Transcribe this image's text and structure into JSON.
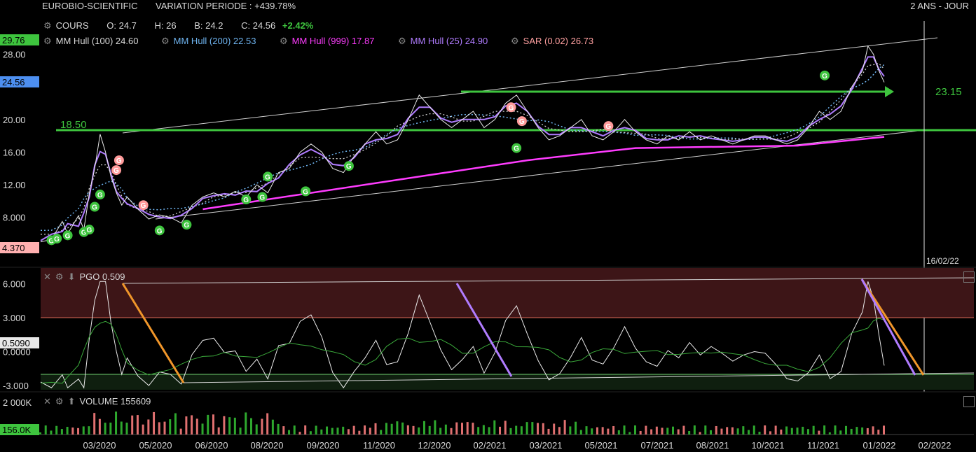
{
  "header": {
    "symbol": "EUROBIO-SCIENTIFIC",
    "variation": "VARIATION PERIODE : +439.78%",
    "period": "2 ANS - JOUR"
  },
  "ohlc": {
    "label": "COURS",
    "o_label": "O:",
    "o": "24.7",
    "h_label": "H:",
    "h": "26",
    "b_label": "B:",
    "b": "24.2",
    "c_label": "C:",
    "c": "24.56",
    "change": "+2.42%"
  },
  "legend": [
    {
      "name": "MM Hull (100)",
      "value": "24.60",
      "color": "#d0d0d0"
    },
    {
      "name": "MM Hull (200)",
      "value": "22.53",
      "color": "#6fb4f0"
    },
    {
      "name": "MM Hull (999)",
      "value": "17.87",
      "color": "#ff3cff"
    },
    {
      "name": "MM Hull (25)",
      "value": "24.90",
      "color": "#b07cff"
    },
    {
      "name": "SAR (0.02)",
      "value": "26.73",
      "color": "#ffa0a0"
    }
  ],
  "price_axis": {
    "ticks": [
      "28.00",
      "20.00",
      "16.00",
      "12.00",
      "8.000"
    ],
    "badge_high": "29.76",
    "badge_last": "24.56",
    "badge_low": "4.370",
    "level_1": "18.50",
    "level_2": "23.15"
  },
  "cursor_date": "16/02/22",
  "pgo": {
    "label": "PGO",
    "value": "0.509",
    "ticks": [
      "6.000",
      "3.000",
      "0.0000",
      "-3.000"
    ],
    "badge": "0.5090"
  },
  "volume": {
    "label": "VOLUME",
    "value": "155609",
    "top_tick": "2 000K",
    "badge": "156.0K"
  },
  "x_axis": [
    "03/2020",
    "05/2020",
    "06/2020",
    "08/2020",
    "09/2020",
    "11/2020",
    "12/2020",
    "02/2021",
    "03/2021",
    "05/2021",
    "07/2021",
    "08/2021",
    "10/2021",
    "11/2021",
    "01/2022",
    "02/2022"
  ],
  "colors": {
    "green": "#3ec43e",
    "pink": "#ff9a9a",
    "purple": "#b07cff",
    "magenta": "#ff3cff",
    "blue": "#6fb4f0",
    "orange": "#f0962a",
    "overbought_zone": "#3d1517",
    "oversold_zone": "#0f1f0f"
  },
  "chart_data": {
    "type": "line",
    "title": "EUROBIO-SCIENTIFIC",
    "x_range": [
      "01/2020",
      "02/2022"
    ],
    "price_ylim": [
      4.37,
      29.76
    ],
    "series": [
      {
        "name": "COURS",
        "points": [
          [
            0,
            5.0
          ],
          [
            2,
            5.3
          ],
          [
            4,
            7.5
          ],
          [
            5,
            6.0
          ],
          [
            7,
            8.2
          ],
          [
            8,
            6.5
          ],
          [
            9,
            11
          ],
          [
            10,
            14
          ],
          [
            11,
            18.2
          ],
          [
            12,
            16
          ],
          [
            13,
            13
          ],
          [
            14,
            11
          ],
          [
            15,
            9.5
          ],
          [
            16,
            10.5
          ],
          [
            18,
            9
          ],
          [
            20,
            7.8
          ],
          [
            22,
            8.3
          ],
          [
            24,
            8
          ],
          [
            26,
            7.3
          ],
          [
            28,
            9.5
          ],
          [
            30,
            10.5
          ],
          [
            32,
            11
          ],
          [
            34,
            10.5
          ],
          [
            36,
            11.2
          ],
          [
            38,
            10.5
          ],
          [
            40,
            12
          ],
          [
            42,
            11
          ],
          [
            44,
            13.5
          ],
          [
            46,
            14
          ],
          [
            48,
            16
          ],
          [
            50,
            17
          ],
          [
            52,
            16
          ],
          [
            54,
            14
          ],
          [
            56,
            13.5
          ],
          [
            58,
            15.5
          ],
          [
            60,
            17
          ],
          [
            62,
            18.5
          ],
          [
            64,
            17
          ],
          [
            66,
            17.5
          ],
          [
            68,
            20
          ],
          [
            70,
            23
          ],
          [
            72,
            21.5
          ],
          [
            74,
            20
          ],
          [
            76,
            19
          ],
          [
            78,
            20
          ],
          [
            80,
            21
          ],
          [
            82,
            19
          ],
          [
            84,
            20
          ],
          [
            86,
            22
          ],
          [
            88,
            23
          ],
          [
            90,
            21
          ],
          [
            92,
            19
          ],
          [
            94,
            17.5
          ],
          [
            96,
            18
          ],
          [
            98,
            19
          ],
          [
            100,
            20
          ],
          [
            102,
            18
          ],
          [
            104,
            17.5
          ],
          [
            106,
            18.5
          ],
          [
            108,
            20
          ],
          [
            110,
            18.5
          ],
          [
            112,
            17.5
          ],
          [
            114,
            17
          ],
          [
            116,
            18
          ],
          [
            118,
            17.5
          ],
          [
            120,
            18.5
          ],
          [
            122,
            17.5
          ],
          [
            124,
            18
          ],
          [
            126,
            17.5
          ],
          [
            128,
            17
          ],
          [
            130,
            17.5
          ],
          [
            132,
            18
          ],
          [
            134,
            18
          ],
          [
            136,
            17.5
          ],
          [
            138,
            17
          ],
          [
            140,
            17.5
          ],
          [
            142,
            19
          ],
          [
            144,
            21
          ],
          [
            146,
            20
          ],
          [
            148,
            21
          ],
          [
            150,
            24
          ],
          [
            152,
            26
          ],
          [
            153,
            29
          ],
          [
            154,
            28
          ],
          [
            155,
            26
          ],
          [
            156,
            24.56
          ]
        ]
      },
      {
        "name": "MM Hull (999)",
        "points": [
          [
            30,
            9
          ],
          [
            60,
            12
          ],
          [
            90,
            15
          ],
          [
            110,
            16.5
          ],
          [
            140,
            16.8
          ],
          [
            156,
            17.87
          ]
        ]
      }
    ],
    "pgo": {
      "ylim": [
        -3.5,
        7.0
      ],
      "overbought": 3.0,
      "oversold": -3.0
    },
    "volume": {
      "ylim": [
        0,
        2000000
      ],
      "last": 155609
    }
  }
}
